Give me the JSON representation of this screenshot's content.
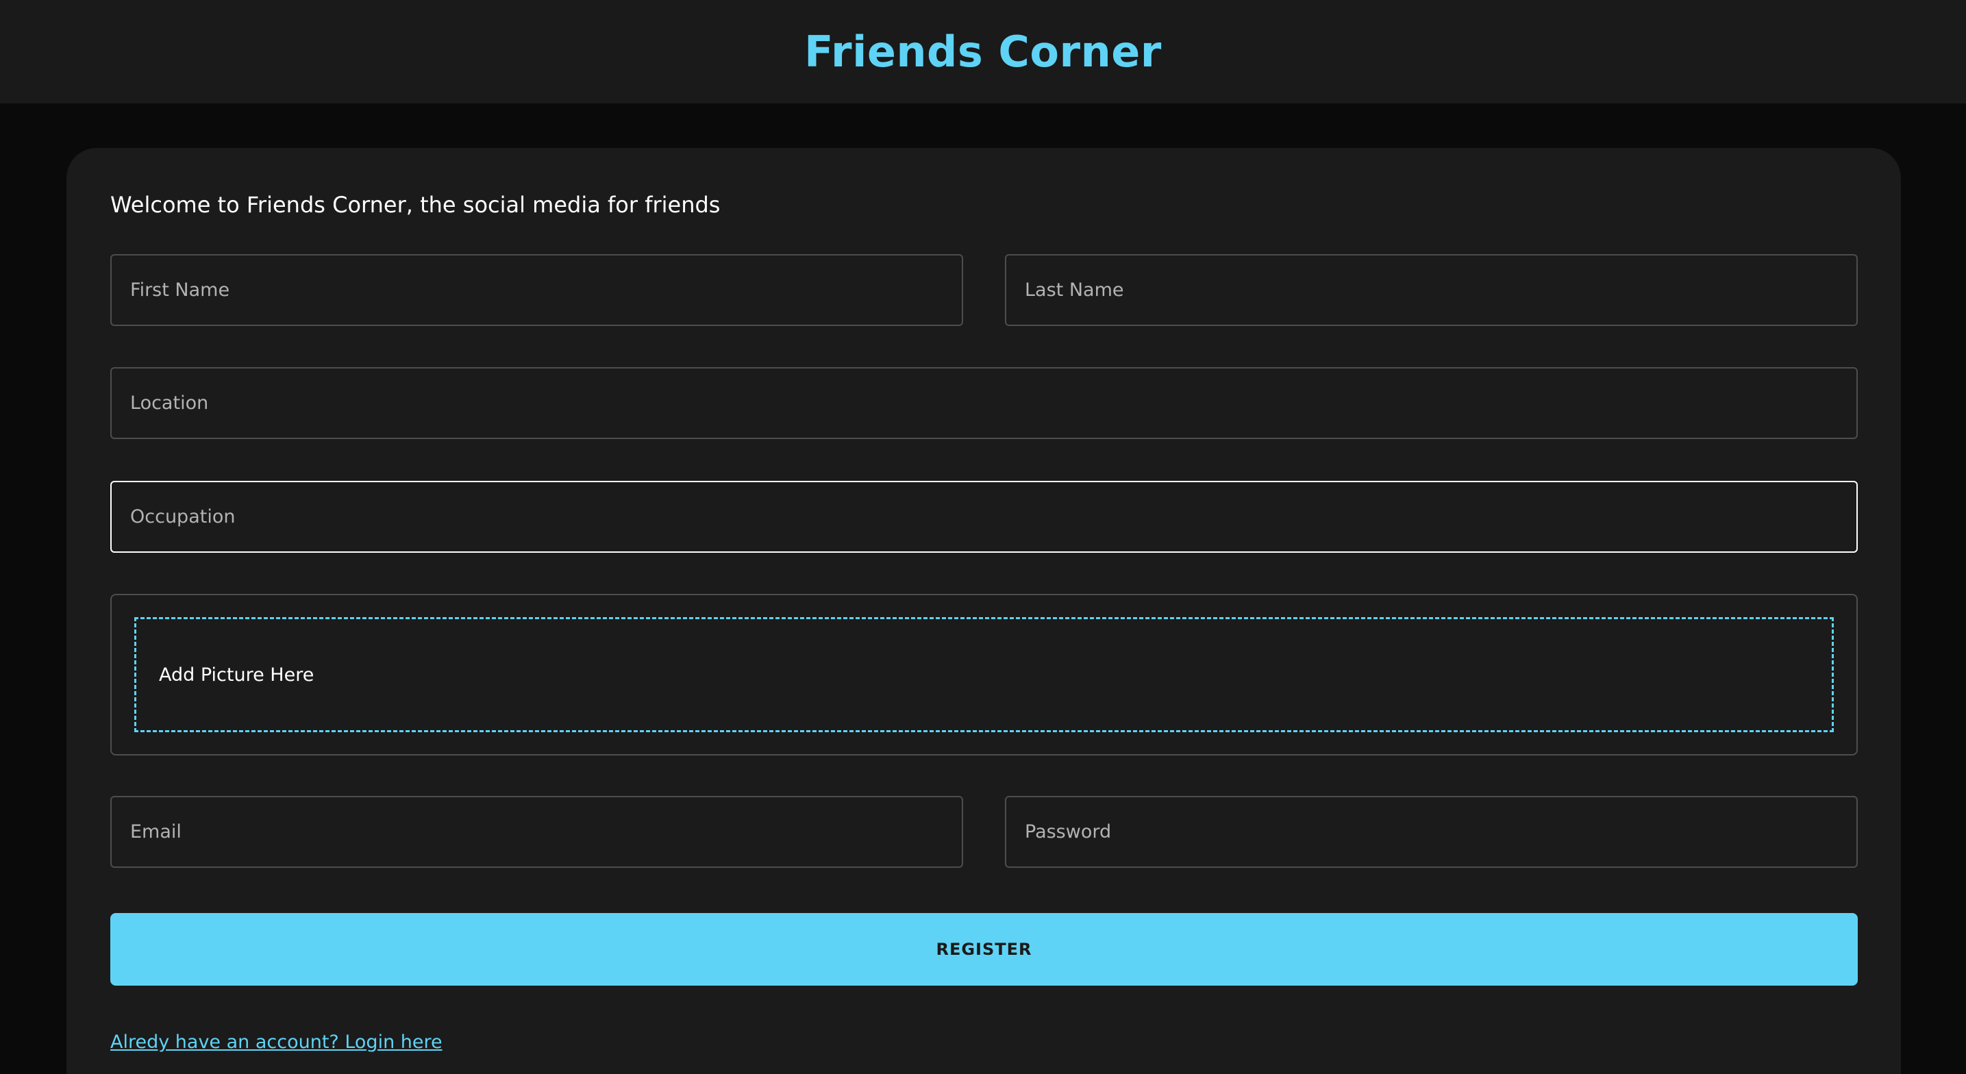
{
  "header": {
    "title": "Friends Corner"
  },
  "form": {
    "welcome": "Welcome to Friends Corner, the social media for friends",
    "fields": {
      "first_name": {
        "placeholder": "First Name",
        "value": ""
      },
      "last_name": {
        "placeholder": "Last Name",
        "value": ""
      },
      "location": {
        "placeholder": "Location",
        "value": ""
      },
      "occupation": {
        "placeholder": "Occupation",
        "value": ""
      },
      "email": {
        "placeholder": "Email",
        "value": ""
      },
      "password": {
        "placeholder": "Password",
        "value": ""
      }
    },
    "picture_dropzone_label": "Add Picture Here",
    "register_label": "REGISTER",
    "login_link": "Alredy have an account? Login here"
  },
  "colors": {
    "accent": "#5fd3f5",
    "page_background": "#0a0a0a",
    "card_background": "#1b1b1b",
    "header_background": "#1a1a1a",
    "field_border": "#4d4d4d",
    "focused_border": "#ffffff"
  }
}
